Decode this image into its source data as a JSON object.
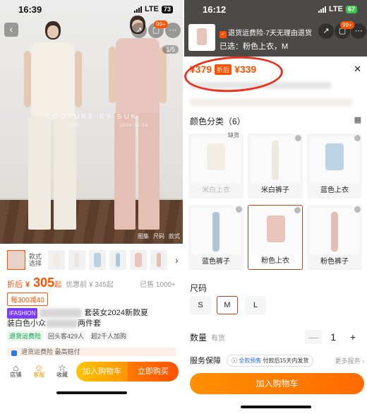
{
  "left": {
    "status": {
      "time": "16:39",
      "network": "LTE",
      "battery": "73"
    },
    "hero": {
      "watermark": "COUTURE BY SUK",
      "wm_sub_1": "1005",
      "wm_sub_2": "2024.01.24",
      "cart_badge": "99+",
      "pager": "1/5",
      "tag_1": "图集",
      "tag_2": "尺码",
      "tag_3": "款式"
    },
    "thumb_label": "款式选择",
    "price": {
      "after_label": "折后",
      "currency": "¥",
      "value": "305",
      "suffix": "起",
      "coupon_before": "优惠前 ¥ 345起",
      "sold": "已售 1000+"
    },
    "promo": "每300减40",
    "title": {
      "brand": "IFASHION",
      "text_1": "套装女2024新款夏",
      "text_2": "装白色小众",
      "text_3": "两件套"
    },
    "badges": [
      "退货运费险",
      "回头客429人",
      "超2千人加购"
    ],
    "shipping": "退货运费险 最高赔付",
    "bottom": {
      "shop": "店铺",
      "service": "客服",
      "fav": "收藏",
      "add_cart": "加入购物车",
      "buy_now": "立即购买"
    }
  },
  "right": {
    "status": {
      "time": "16:12",
      "network": "LTE",
      "battery": "67"
    },
    "return_text": "退货运费险·7天无理由退货",
    "selected": "已选：粉色上衣，M",
    "cart_badge": "99+",
    "price_old": "¥379",
    "after_label": "折后",
    "price_new": "¥339",
    "color_section": "颜色分类（6）",
    "tiles": [
      {
        "label": "米白上衣",
        "stock": "缺货",
        "dim": true
      },
      {
        "label": "米白裤子"
      },
      {
        "label": "蓝色上衣"
      },
      {
        "label": "蓝色裤子"
      },
      {
        "label": "粉色上衣",
        "selected": true
      },
      {
        "label": "粉色裤子"
      }
    ],
    "size_section": "尺码",
    "sizes": [
      "S",
      "M",
      "L"
    ],
    "qty_label": "数量",
    "qty_stock": "有货",
    "qty_value": "1",
    "service_label": "服务保障",
    "service_prefix": "全款预售",
    "service_text": "付款后15天内发货",
    "service_more": "更多服务 ›",
    "add_cart": "加入购物车"
  },
  "colors": {
    "accent": "#ff5000",
    "orange": "#ff9000",
    "annotation_red": "#e8321f"
  }
}
